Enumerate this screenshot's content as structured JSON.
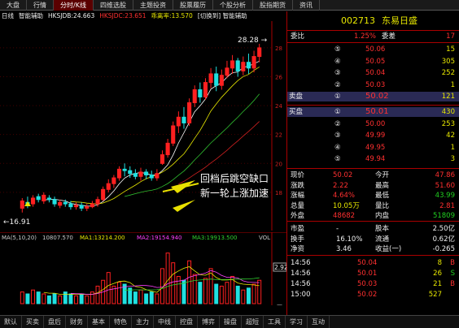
{
  "top_tabs": [
    "大盘",
    "行情",
    "分时/K线",
    "四维选股",
    "主题投资",
    "股票履历",
    "个股分析",
    "股指期货",
    "资讯"
  ],
  "active_tab": 2,
  "indicator_row": [
    "日线",
    "智能辅助",
    "HKSJDB:24.663",
    "HKSJDC:23.651",
    "乖离率:13.570",
    "[切换到] 智能辅助"
  ],
  "main_chart": {
    "high_label": "28.28",
    "low_label": "16.91",
    "annotation_line1": "回档后跳空缺口",
    "annotation_line2": "新一轮上涨加速",
    "price_axis": [
      "28",
      "26",
      "24",
      "22",
      "20",
      "18"
    ],
    "candles": [
      {
        "o": 16.9,
        "c": 17.4,
        "h": 17.6,
        "l": 16.6
      },
      {
        "o": 17.3,
        "c": 17.1,
        "h": 17.7,
        "l": 16.9
      },
      {
        "o": 17.2,
        "c": 17.6,
        "h": 17.8,
        "l": 17.0
      },
      {
        "o": 17.7,
        "c": 17.5,
        "h": 17.9,
        "l": 17.3
      },
      {
        "o": 17.4,
        "c": 17.8,
        "h": 18.0,
        "l": 17.2
      },
      {
        "o": 17.6,
        "c": 17.5,
        "h": 17.8,
        "l": 17.3
      },
      {
        "o": 17.5,
        "c": 17.2,
        "h": 17.7,
        "l": 17.0
      },
      {
        "o": 17.1,
        "c": 17.3,
        "h": 17.5,
        "l": 16.9
      },
      {
        "o": 17.3,
        "c": 17.2,
        "h": 17.5,
        "l": 17.0
      },
      {
        "o": 17.2,
        "c": 17.0,
        "h": 17.4,
        "l": 16.8
      },
      {
        "o": 17.0,
        "c": 17.1,
        "h": 17.3,
        "l": 16.8
      },
      {
        "o": 17.1,
        "c": 16.9,
        "h": 17.3,
        "l": 16.7
      },
      {
        "o": 16.9,
        "c": 17.0,
        "h": 17.2,
        "l": 16.7
      },
      {
        "o": 17.0,
        "c": 17.2,
        "h": 17.4,
        "l": 16.9
      },
      {
        "o": 17.2,
        "c": 17.5,
        "h": 17.7,
        "l": 17.0
      },
      {
        "o": 17.5,
        "c": 18.2,
        "h": 18.4,
        "l": 17.4
      },
      {
        "o": 18.2,
        "c": 18.6,
        "h": 18.9,
        "l": 18.0
      },
      {
        "o": 18.6,
        "c": 19.0,
        "h": 19.2,
        "l": 18.3
      },
      {
        "o": 19.0,
        "c": 19.6,
        "h": 19.8,
        "l": 18.8
      },
      {
        "o": 19.6,
        "c": 19.5,
        "h": 20.0,
        "l": 19.1
      },
      {
        "o": 19.5,
        "c": 19.3,
        "h": 19.8,
        "l": 19.0
      },
      {
        "o": 19.3,
        "c": 19.1,
        "h": 19.6,
        "l": 18.9
      },
      {
        "o": 19.1,
        "c": 19.4,
        "h": 19.7,
        "l": 18.8
      },
      {
        "o": 19.4,
        "c": 19.2,
        "h": 19.6,
        "l": 18.9
      },
      {
        "o": 19.2,
        "c": 19.0,
        "h": 19.5,
        "l": 18.8
      },
      {
        "o": 19.0,
        "c": 19.3,
        "h": 19.6,
        "l": 18.8
      },
      {
        "o": 20.0,
        "c": 20.6,
        "h": 20.9,
        "l": 19.9
      },
      {
        "o": 20.6,
        "c": 21.4,
        "h": 21.7,
        "l": 20.4
      },
      {
        "o": 21.4,
        "c": 22.6,
        "h": 22.9,
        "l": 21.2
      },
      {
        "o": 22.6,
        "c": 23.2,
        "h": 23.6,
        "l": 22.1
      },
      {
        "o": 23.2,
        "c": 22.8,
        "h": 23.9,
        "l": 22.4
      },
      {
        "o": 22.8,
        "c": 24.2,
        "h": 24.5,
        "l": 22.6
      },
      {
        "o": 24.2,
        "c": 25.1,
        "h": 25.4,
        "l": 23.9
      },
      {
        "o": 25.1,
        "c": 24.6,
        "h": 25.6,
        "l": 24.2
      },
      {
        "o": 24.6,
        "c": 25.6,
        "h": 25.9,
        "l": 24.4
      },
      {
        "o": 25.6,
        "c": 26.2,
        "h": 26.6,
        "l": 25.2
      },
      {
        "o": 26.2,
        "c": 25.4,
        "h": 26.7,
        "l": 25.0
      },
      {
        "o": 25.4,
        "c": 26.1,
        "h": 26.5,
        "l": 25.1
      },
      {
        "o": 26.1,
        "c": 26.6,
        "h": 27.1,
        "l": 25.9
      },
      {
        "o": 26.6,
        "c": 27.1,
        "h": 27.5,
        "l": 26.2
      },
      {
        "o": 27.1,
        "c": 26.4,
        "h": 27.3,
        "l": 26.0
      },
      {
        "o": 26.4,
        "c": 27.0,
        "h": 27.4,
        "l": 26.1
      },
      {
        "o": 27.0,
        "c": 26.6,
        "h": 27.6,
        "l": 26.2
      },
      {
        "o": 26.6,
        "c": 27.4,
        "h": 27.8,
        "l": 26.3
      },
      {
        "o": 27.4,
        "c": 28.0,
        "h": 28.28,
        "l": 27.0
      }
    ]
  },
  "volume_panel": {
    "label_ma": "MA(5,10,20)",
    "v1": "10807.570",
    "ma1": "MA1:13214.200",
    "ma2": "MA2:19154.940",
    "ma3": "MA3:19913.500",
    "vol_label": "VOL",
    "axis_value": "2.92",
    "unit": "万",
    "volumes": [
      0.6,
      0.5,
      0.7,
      0.6,
      0.5,
      0.4,
      0.5,
      0.4,
      0.6,
      0.5,
      0.4,
      0.5,
      0.4,
      0.6,
      0.9,
      1.2,
      1.6,
      0.9,
      1.1,
      1.0,
      0.8,
      0.6,
      0.7,
      0.5,
      0.6,
      0.5,
      1.8,
      2.6,
      2.1,
      1.4,
      1.2,
      2.2,
      1.5,
      1.1,
      1.3,
      1.8,
      1.0,
      0.9,
      1.1,
      1.4,
      0.9,
      0.7,
      0.8,
      1.0,
      1.2
    ]
  },
  "x_axis": {
    "left": "2015",
    "mid": "2",
    "right": "2015/ 2/17/二"
  },
  "bottom_tabs": [
    "默认",
    "买卖",
    "盘后",
    "财务",
    "基本",
    "特色",
    "主力",
    "中线",
    "控盘",
    "博弈",
    "操盘",
    "超短",
    "工具",
    "学习",
    "互动"
  ],
  "stock": {
    "code": "002713",
    "name": "东易日盛"
  },
  "order_book": {
    "weibi_label": "委比",
    "weibi": "1.25%",
    "weicha_label": "委差",
    "weicha": "17",
    "sell_label": "卖盘",
    "buy_label": "买盘",
    "sells": [
      {
        "n": "⑤",
        "p": "50.06",
        "v": "15"
      },
      {
        "n": "④",
        "p": "50.05",
        "v": "305"
      },
      {
        "n": "③",
        "p": "50.04",
        "v": "252"
      },
      {
        "n": "②",
        "p": "50.03",
        "v": "1"
      },
      {
        "n": "①",
        "p": "50.02",
        "v": "121"
      }
    ],
    "buys": [
      {
        "n": "①",
        "p": "50.01",
        "v": "430"
      },
      {
        "n": "②",
        "p": "50.00",
        "v": "253"
      },
      {
        "n": "③",
        "p": "49.99",
        "v": "42"
      },
      {
        "n": "④",
        "p": "49.95",
        "v": "1"
      },
      {
        "n": "⑤",
        "p": "49.94",
        "v": "3"
      }
    ]
  },
  "quote": [
    {
      "l1": "现价",
      "v1": "50.02",
      "c1": "red",
      "l2": "今开",
      "v2": "47.86",
      "c2": "red"
    },
    {
      "l1": "涨跌",
      "v1": "2.22",
      "c1": "red",
      "l2": "最高",
      "v2": "51.60",
      "c2": "red"
    },
    {
      "l1": "涨幅",
      "v1": "4.64%",
      "c1": "red",
      "l2": "最低",
      "v2": "43.99",
      "c2": "green"
    },
    {
      "l1": "总量",
      "v1": "10.05万",
      "c1": "yellow",
      "l2": "量比",
      "v2": "2.81",
      "c2": "red"
    },
    {
      "l1": "外盘",
      "v1": "48682",
      "c1": "red",
      "l2": "内盘",
      "v2": "51809",
      "c2": "green"
    }
  ],
  "fundamentals": [
    {
      "l1": "市盈",
      "v1": "-",
      "l2": "股本",
      "v2": "2.50亿"
    },
    {
      "l1": "换手",
      "v1": "16.10%",
      "l2": "流通",
      "v2": "0.62亿"
    },
    {
      "l1": "净资",
      "v1": "3.46",
      "l2": "收益(一)",
      "v2": "-0.265"
    }
  ],
  "ticks": [
    {
      "t": "14:56",
      "p": "50.04",
      "v": "8",
      "d": "B",
      "dc": "red"
    },
    {
      "t": "14:56",
      "p": "50.01",
      "v": "26",
      "d": "S",
      "dc": "green"
    },
    {
      "t": "14:56",
      "p": "50.03",
      "v": "21",
      "d": "B",
      "dc": "red"
    },
    {
      "t": "15:00",
      "p": "50.02",
      "v": "527",
      "d": "",
      "dc": "red"
    }
  ]
}
